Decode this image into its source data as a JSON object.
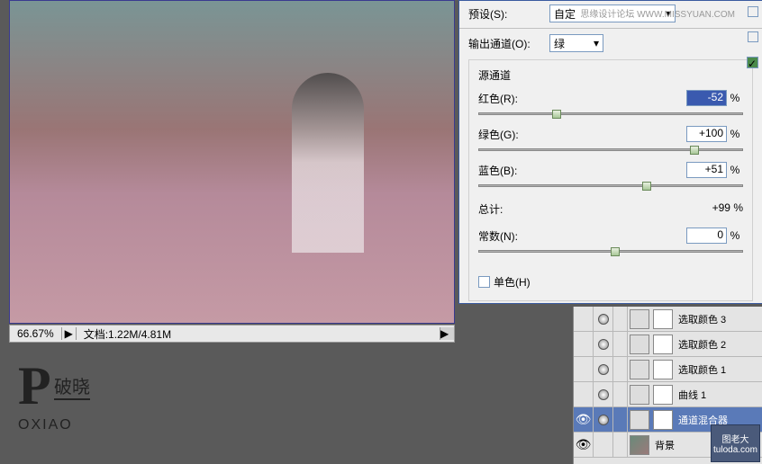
{
  "preset": {
    "label": "预设(S):",
    "value": "自定"
  },
  "output_channel": {
    "label": "输出通道(O):",
    "value": "绿"
  },
  "source_channels": {
    "label": "源通道",
    "red": {
      "label": "红色(R):",
      "value": "-52",
      "pos": 28
    },
    "green": {
      "label": "绿色(G):",
      "value": "+100",
      "pos": 80
    },
    "blue": {
      "label": "蓝色(B):",
      "value": "+51",
      "pos": 62
    }
  },
  "total": {
    "label": "总计:",
    "value": "+99",
    "percent": "%"
  },
  "constant": {
    "label": "常数(N):",
    "value": "0",
    "pos": 50
  },
  "monochrome": {
    "label": "单色(H)"
  },
  "watermark": "思缘设计论坛  WWW.MISSYUAN.COM",
  "status": {
    "zoom": "66.67%",
    "doc": "文档:1.22M/4.81M",
    "play": "▶",
    "arrow": "▶"
  },
  "logo": {
    "big": "P",
    "cn": "破晓",
    "en": "OXIAO"
  },
  "layers": [
    {
      "visible": false,
      "name": "选取颜色 3"
    },
    {
      "visible": false,
      "name": "选取颜色 2"
    },
    {
      "visible": false,
      "name": "选取颜色 1"
    },
    {
      "visible": false,
      "name": "曲线 1"
    },
    {
      "visible": true,
      "name": "通道混合器",
      "selected": true
    },
    {
      "visible": true,
      "name": "背景",
      "bg": true
    }
  ],
  "percent": "%",
  "badge": {
    "line1": "图老大",
    "line2": "tuloda.com"
  }
}
